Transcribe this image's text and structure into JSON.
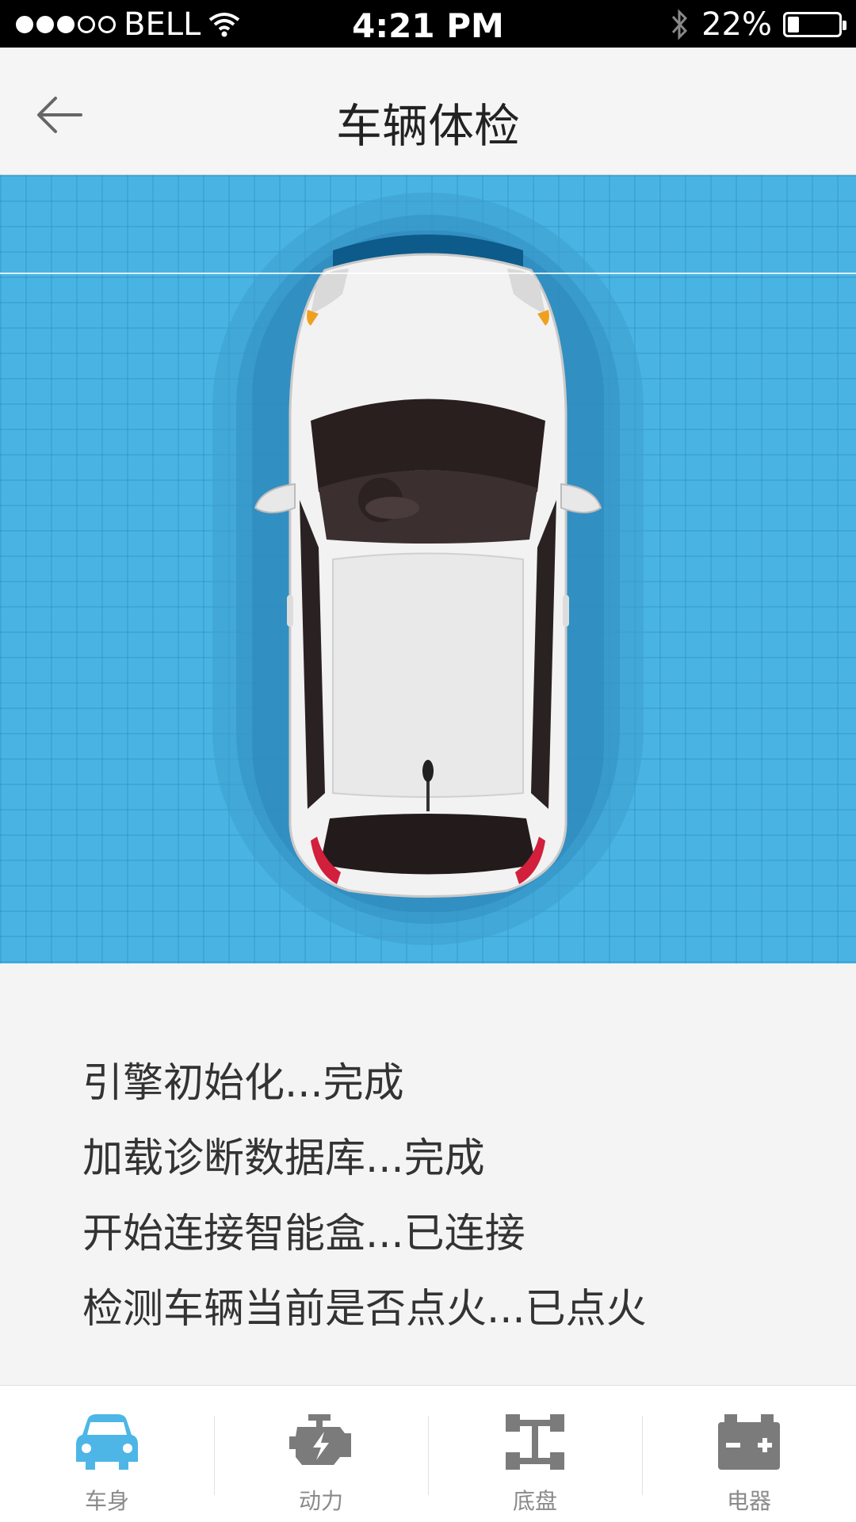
{
  "status_bar": {
    "carrier": "BELL",
    "signal_filled": 3,
    "signal_total": 5,
    "time": "4:21 PM",
    "battery": "22%",
    "battery_level": 0.22,
    "icons": [
      "wifi-icon",
      "bluetooth-icon",
      "battery-icon"
    ]
  },
  "nav": {
    "title": "车辆体检",
    "back_icon": "arrow-left-icon"
  },
  "log": [
    "引擎初始化...完成",
    "加载诊断数据库...完成",
    "开始连接智能盒...已连接",
    "检测车辆当前是否点火...已点火"
  ],
  "tabs": [
    {
      "label": "车身",
      "icon": "car-icon",
      "active": true
    },
    {
      "label": "动力",
      "icon": "engine-icon",
      "active": false
    },
    {
      "label": "底盘",
      "icon": "chassis-icon",
      "active": false
    },
    {
      "label": "电器",
      "icon": "battery-icon",
      "active": false
    }
  ],
  "colors": {
    "accent": "#4db6e6",
    "grid_background": "#49b4e3",
    "tab_inactive": "#8a8a8a"
  }
}
